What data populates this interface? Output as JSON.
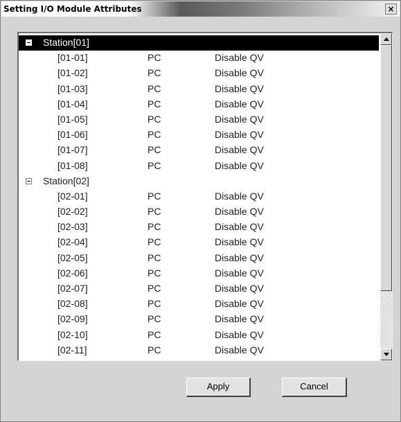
{
  "window": {
    "title": "Setting I/O Module Attributes",
    "close_label": "×"
  },
  "tree": {
    "stations": [
      {
        "label": "Station[01]",
        "selected": true,
        "expanded": true,
        "modules": [
          {
            "id": "[01-01]",
            "type": "PC",
            "attr": "Disable QV"
          },
          {
            "id": "[01-02]",
            "type": "PC",
            "attr": "Disable QV"
          },
          {
            "id": "[01-03]",
            "type": "PC",
            "attr": "Disable QV"
          },
          {
            "id": "[01-04]",
            "type": "PC",
            "attr": "Disable QV"
          },
          {
            "id": "[01-05]",
            "type": "PC",
            "attr": "Disable QV"
          },
          {
            "id": "[01-06]",
            "type": "PC",
            "attr": "Disable QV"
          },
          {
            "id": "[01-07]",
            "type": "PC",
            "attr": "Disable QV"
          },
          {
            "id": "[01-08]",
            "type": "PC",
            "attr": "Disable QV"
          }
        ]
      },
      {
        "label": "Station[02]",
        "selected": false,
        "expanded": true,
        "modules": [
          {
            "id": "[02-01]",
            "type": "PC",
            "attr": "Disable QV"
          },
          {
            "id": "[02-02]",
            "type": "PC",
            "attr": "Disable QV"
          },
          {
            "id": "[02-03]",
            "type": "PC",
            "attr": "Disable QV"
          },
          {
            "id": "[02-04]",
            "type": "PC",
            "attr": "Disable QV"
          },
          {
            "id": "[02-05]",
            "type": "PC",
            "attr": "Disable QV"
          },
          {
            "id": "[02-06]",
            "type": "PC",
            "attr": "Disable QV"
          },
          {
            "id": "[02-07]",
            "type": "PC",
            "attr": "Disable QV"
          },
          {
            "id": "[02-08]",
            "type": "PC",
            "attr": "Disable QV"
          },
          {
            "id": "[02-09]",
            "type": "PC",
            "attr": "Disable QV"
          },
          {
            "id": "[02-10]",
            "type": "PC",
            "attr": "Disable QV"
          },
          {
            "id": "[02-11]",
            "type": "PC",
            "attr": "Disable QV"
          }
        ]
      }
    ]
  },
  "buttons": {
    "apply_label": "Apply",
    "cancel_label": "Cancel"
  },
  "colors": {
    "dialog_bg": "#d4d4d4",
    "selection_bg": "#000000",
    "selection_text": "#ffffff"
  }
}
